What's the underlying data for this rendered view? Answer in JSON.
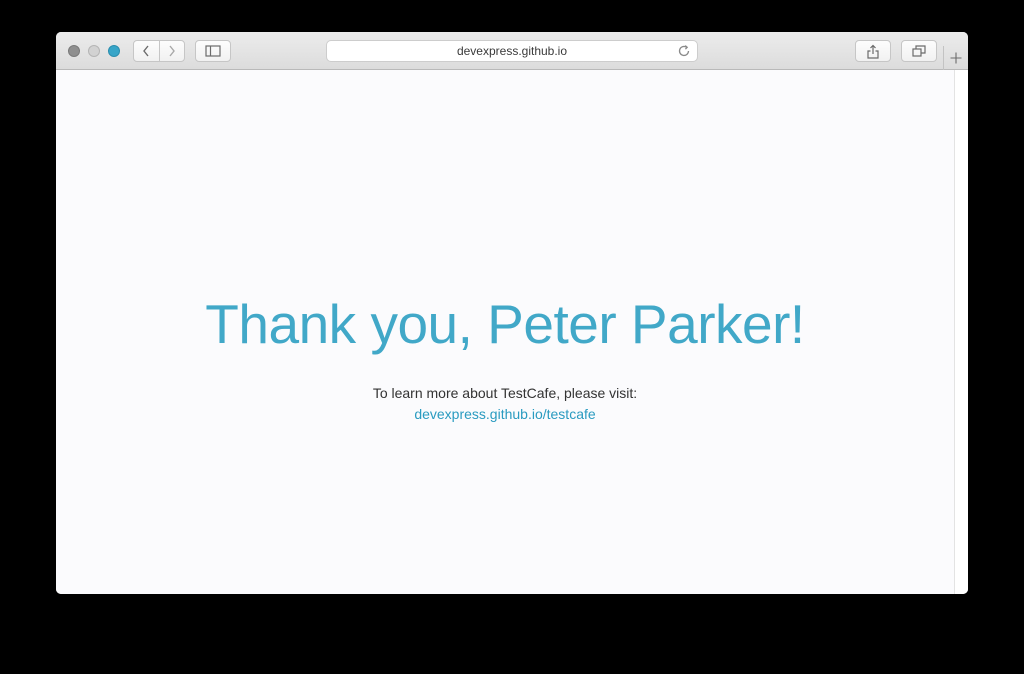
{
  "browser": {
    "address_bar": {
      "url": "devexpress.github.io"
    }
  },
  "page": {
    "heading": "Thank you, Peter Parker!",
    "learn_more_text": "To learn more about TestCafe, please visit:",
    "link_text": "devexpress.github.io/testcafe"
  },
  "icons": {
    "back": "chevron-left-icon",
    "forward": "chevron-right-icon",
    "sidebar": "sidebar-icon",
    "reload": "reload-icon",
    "share": "share-icon",
    "tabs": "tabs-overview-icon",
    "new_tab": "plus-icon"
  },
  "colors": {
    "accent": "#41a8c8",
    "link": "#2a9bc0",
    "maximize_button": "#37a5c8"
  }
}
